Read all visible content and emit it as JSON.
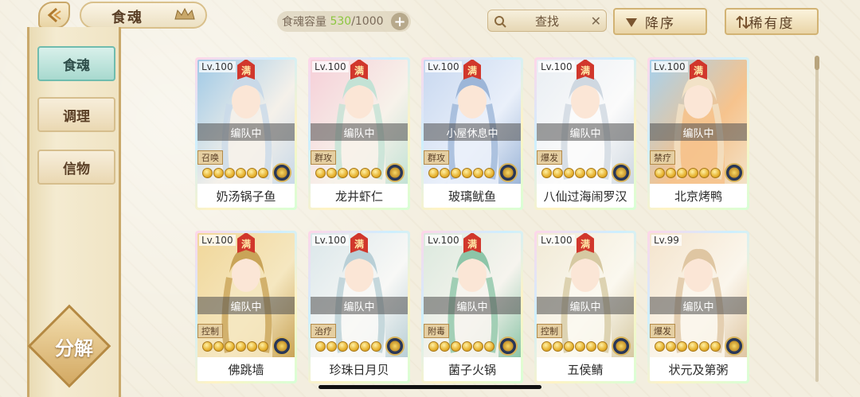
{
  "header": {
    "title": "食魂",
    "capacity_label": "食魂容量",
    "capacity_current": "530",
    "capacity_max": "/1000",
    "search_label": "查找",
    "sort_order_label": "降序",
    "sort_key_label": "稀有度"
  },
  "sidebar": {
    "items": [
      {
        "label": "食魂",
        "active": true
      },
      {
        "label": "调理",
        "active": false
      },
      {
        "label": "信物",
        "active": false
      }
    ],
    "decompose_label": "分解"
  },
  "cards": [
    {
      "level": "Lv.100",
      "max": "满",
      "status": "编队中",
      "role": "召唤",
      "name": "奶汤锅子鱼",
      "colors": [
        "#9fc9e6",
        "#f5f1ea",
        "#c9d9e8"
      ]
    },
    {
      "level": "Lv.100",
      "max": "满",
      "status": "编队中",
      "role": "群攻",
      "name": "龙井虾仁",
      "colors": [
        "#f6cfd8",
        "#f7f2ea",
        "#c3e2d5"
      ]
    },
    {
      "level": "Lv.100",
      "max": "满",
      "status": "小屋休息中",
      "role": "群攻",
      "name": "玻璃鱿鱼",
      "colors": [
        "#c8d8f0",
        "#eaf0fa",
        "#9db6d8"
      ]
    },
    {
      "level": "Lv.100",
      "max": "满",
      "status": "编队中",
      "role": "爆发",
      "name": "八仙过海闹罗汉",
      "colors": [
        "#e9eef3",
        "#fbfbfb",
        "#cfd8e1"
      ]
    },
    {
      "level": "Lv.100",
      "max": "满",
      "status": "编队中",
      "role": "禁疗",
      "name": "北京烤鸭",
      "colors": [
        "#a6d1ee",
        "#f6c38d",
        "#f2e2c7"
      ]
    },
    {
      "level": "Lv.100",
      "max": "满",
      "status": "编队中",
      "role": "控制",
      "name": "佛跳墙",
      "colors": [
        "#f1d79a",
        "#f5e7c0",
        "#c9a458"
      ]
    },
    {
      "level": "Lv.100",
      "max": "满",
      "status": "编队中",
      "role": "治疗",
      "name": "珍珠日月贝",
      "colors": [
        "#dbe7ea",
        "#f8f8f6",
        "#b9cfd6"
      ]
    },
    {
      "level": "Lv.100",
      "max": "满",
      "status": "编队中",
      "role": "附毒",
      "name": "菌子火锅",
      "colors": [
        "#dbe9de",
        "#f6f4ee",
        "#8dc5a8"
      ]
    },
    {
      "level": "Lv.100",
      "max": "满",
      "status": "编队中",
      "role": "控制",
      "name": "五侯鲭",
      "colors": [
        "#f1ead6",
        "#fbf8ef",
        "#d6c9a2"
      ]
    },
    {
      "level": "Lv.99",
      "max": "",
      "status": "编队中",
      "role": "爆发",
      "name": "状元及第粥",
      "colors": [
        "#f4e4cd",
        "#fbf6ec",
        "#dfc6a2"
      ]
    }
  ]
}
